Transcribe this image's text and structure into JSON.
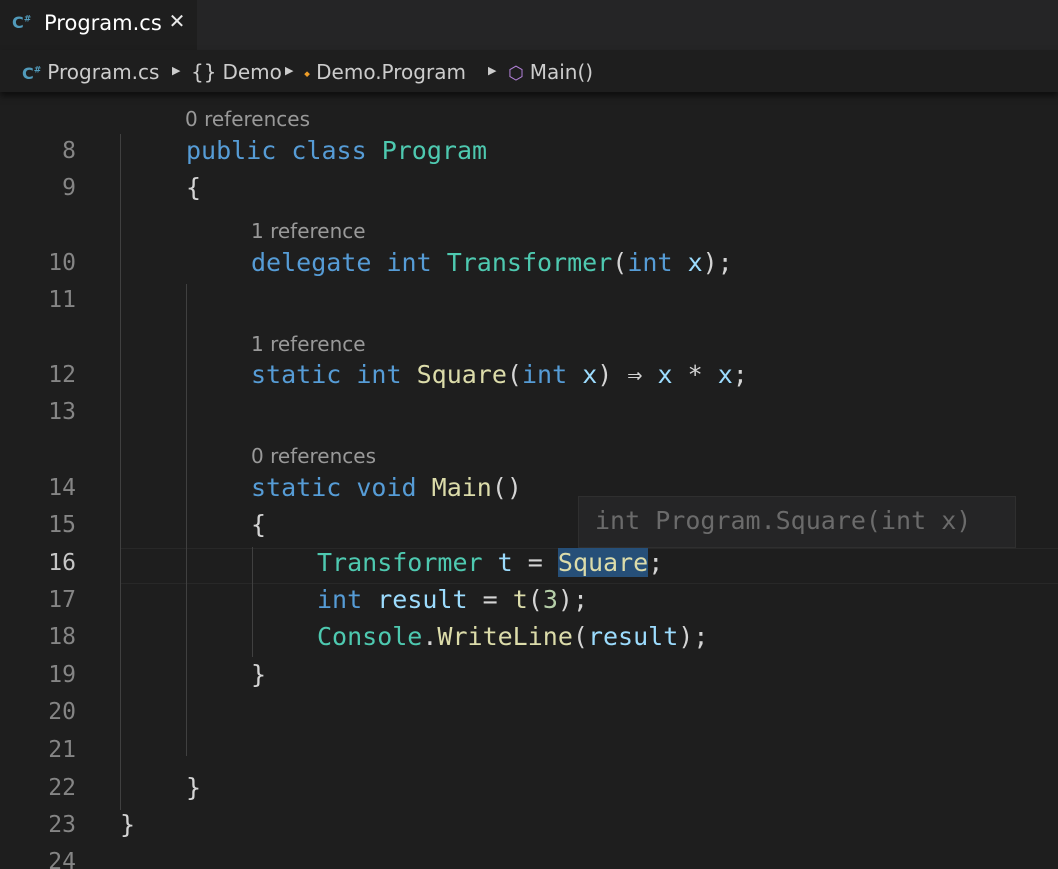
{
  "tab": {
    "icon": "csharp-file-icon",
    "label": "Program.cs",
    "close_glyph": "✕"
  },
  "breadcrumb": [
    {
      "label": "Program.cs",
      "icon": "csharp-file-icon"
    },
    {
      "label": "Demo",
      "icon": "namespace-icon"
    },
    {
      "label": "Demo.Program",
      "icon": "class-icon"
    },
    {
      "label": "Main()",
      "icon": "method-icon"
    }
  ],
  "code_lens": {
    "program": "0 references",
    "transformer": "1 reference",
    "square": "1 reference",
    "main": "0 references"
  },
  "line_numbers": [
    "8",
    "9",
    "10",
    "11",
    "12",
    "13",
    "14",
    "15",
    "16",
    "17",
    "18",
    "19",
    "20",
    "21",
    "22",
    "23",
    "24"
  ],
  "active_line": "16",
  "code": {
    "l8": {
      "kw": "public class",
      "type": "Program"
    },
    "l9": "{",
    "l10": {
      "kw1": "delegate",
      "kw2": "int",
      "type": "Transformer",
      "kw3": "int",
      "param": "x",
      "tail": ");"
    },
    "l12": {
      "kw1": "static",
      "kw2": "int",
      "fn": "Square",
      "kw3": "int",
      "param": "x",
      "arrow": "⇒",
      "x1": "x",
      "op": "*",
      "x2": "x",
      "end": ";"
    },
    "l14": {
      "kw1": "static",
      "kw2": "void",
      "fn": "Main",
      "tail": "()"
    },
    "l15": "{",
    "l16": {
      "type": "Transformer",
      "var": "t",
      "eq": "=",
      "fn": "Square",
      "end": ";"
    },
    "l17": {
      "kw": "int",
      "var": "result",
      "eq": "=",
      "fn": "t",
      "num": "3",
      "end": ");"
    },
    "l18": {
      "type": "Console",
      "fn": "WriteLine",
      "param": "result",
      "end": ");"
    },
    "l19": "}",
    "l22": "}",
    "l23": "}"
  },
  "hover_hint": {
    "kw1": "int",
    "sig": "Program.Square(",
    "kw2": "int",
    "param": "x",
    "end": ")"
  }
}
